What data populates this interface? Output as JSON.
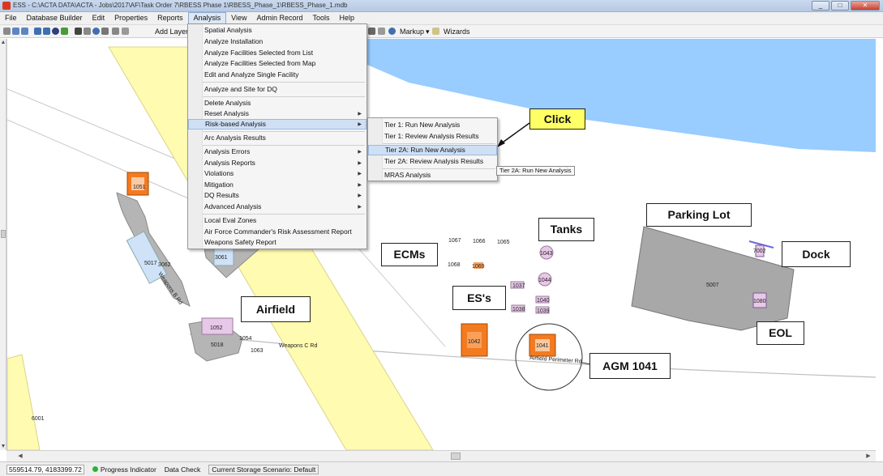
{
  "window": {
    "title": "ESS - C:\\ACTA DATA\\ACTA - Jobs\\2017\\AF\\Task Order 7\\RBESS Phase 1\\RBESS_Phase_1\\RBESS_Phase_1.mdb",
    "controls": [
      "_",
      "□",
      "✕"
    ]
  },
  "menubar": {
    "items": [
      "File",
      "Database Builder",
      "Edit",
      "Properties",
      "Reports",
      "Analysis",
      "View",
      "Admin Record",
      "Tools",
      "Help"
    ],
    "active": "Analysis"
  },
  "toolbar": {
    "add_layer": "Add Layer",
    "markup": "Markup",
    "wizards": "Wizards"
  },
  "analysis_menu": {
    "items": [
      {
        "label": "Spatial Analysis",
        "submenu": false
      },
      {
        "label": "Analyze Installation",
        "submenu": false
      },
      {
        "label": "Analyze Facilities Selected from List",
        "submenu": false
      },
      {
        "label": "Analyze Facilities Selected from Map",
        "submenu": false
      },
      {
        "label": "Edit and Analyze Single Facility",
        "submenu": false
      },
      {
        "label": "Analyze and Site for DQ",
        "submenu": false
      },
      {
        "label": "Delete Analysis",
        "submenu": false
      },
      {
        "label": "Reset Analysis",
        "submenu": true
      },
      {
        "label": "Risk-based Analysis",
        "submenu": true,
        "highlighted": true
      },
      {
        "label": "Arc Analysis Results",
        "submenu": false
      },
      {
        "label": "Analysis Errors",
        "submenu": true
      },
      {
        "label": "Analysis Reports",
        "submenu": true
      },
      {
        "label": "Violations",
        "submenu": true
      },
      {
        "label": "Mitigation",
        "submenu": true
      },
      {
        "label": "DQ Results",
        "submenu": true
      },
      {
        "label": "Advanced Analysis",
        "submenu": true
      },
      {
        "label": "Local Eval Zones",
        "submenu": false
      },
      {
        "label": "Air Force Commander's Risk Assessment Report",
        "submenu": false
      },
      {
        "label": "Weapons Safety Report",
        "submenu": false
      }
    ]
  },
  "risk_submenu": {
    "items": [
      {
        "label": "Tier 1: Run New Analysis"
      },
      {
        "label": "Tier 1: Review Analysis Results"
      },
      {
        "label": "Tier 2A: Run New Analysis",
        "highlighted": true
      },
      {
        "label": "Tier 2A: Review Analysis Results"
      },
      {
        "label": "MRAS Analysis"
      }
    ]
  },
  "tooltip": "Tier 2A: Run New Analysis",
  "callouts": {
    "click": "Click",
    "tanks": "Tanks",
    "parking_lot": "Parking Lot",
    "dock": "Dock",
    "ecms": "ECMs",
    "ess": "ES's",
    "airfield": "Airfield",
    "eol": "EOL",
    "agm": "AGM 1041"
  },
  "map_labels": {
    "b1051": "1051",
    "b3061": "3061",
    "b5017": "5017",
    "b3062": "3062",
    "weapons_b_rd": "Weapons B Rd",
    "b1052": "1052",
    "b1054": "1054",
    "b5018": "5018",
    "b1063": "1063",
    "weapons_c_rd": "Weapons C Rd",
    "b6001": "6001",
    "b1067": "1067",
    "b1066": "1066",
    "b1065": "1065",
    "b1068": "1068",
    "b1069": "1069",
    "b1043": "1043",
    "b1044": "1044",
    "b1037": "1037",
    "b1040": "1040",
    "b1038": "1038",
    "b1039": "1039",
    "b1042": "1042",
    "b1041": "1041",
    "airfield_perimeter_rd": "Airfield Perimeter Rd",
    "b7002": "7002",
    "b5007": "5007",
    "b1080": "1080"
  },
  "statusbar": {
    "coords": "559514.79, 4183399.72",
    "progress": "Progress Indicator",
    "data_check": "Data Check",
    "storage": "Current Storage Scenario: Default"
  },
  "colors": {
    "water": "#99ccff",
    "road_yellow": "#fffbb0",
    "pavement": "#b5b5b5",
    "explosive_site": "#f47a20",
    "facility_pink": "#e8c8e8",
    "callout_yellow": "#ffff66"
  }
}
